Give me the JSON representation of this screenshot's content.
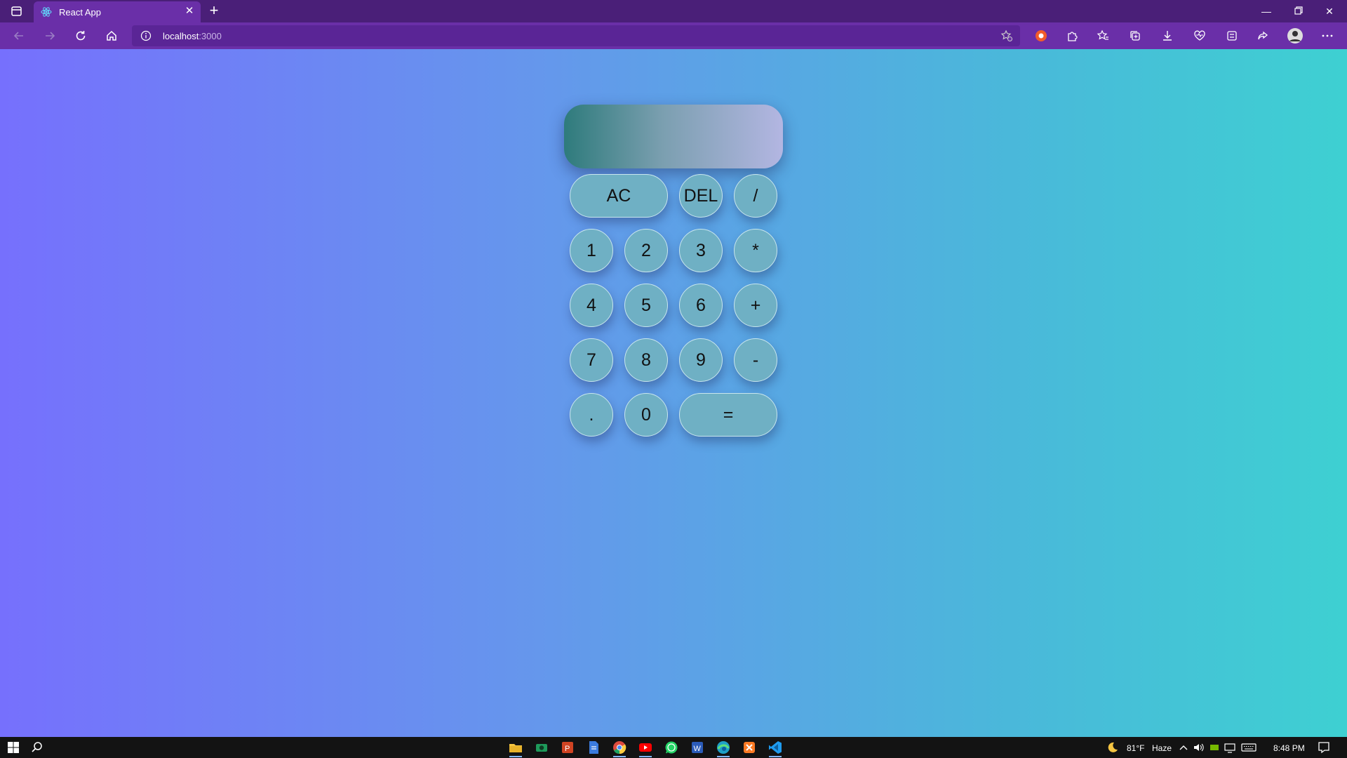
{
  "browser": {
    "tab_title": "React App",
    "url_host": "localhost",
    "url_port": ":3000"
  },
  "calculator": {
    "display_value": "",
    "keys": [
      "AC",
      "DEL",
      "/",
      "1",
      "2",
      "3",
      "*",
      "4",
      "5",
      "6",
      "+",
      "7",
      "8",
      "9",
      "-",
      ".",
      "0",
      "="
    ]
  },
  "taskbar": {
    "weather_temp": "81°F",
    "weather_cond": "Haze",
    "clock": "8:48 PM"
  },
  "colors": {
    "tabbar": "#4a1f78",
    "toolbar": "#6a2fa8",
    "gradient_left": "#7670fd",
    "gradient_right": "#3ed0d2",
    "key_fill": "#6fb0c4"
  }
}
